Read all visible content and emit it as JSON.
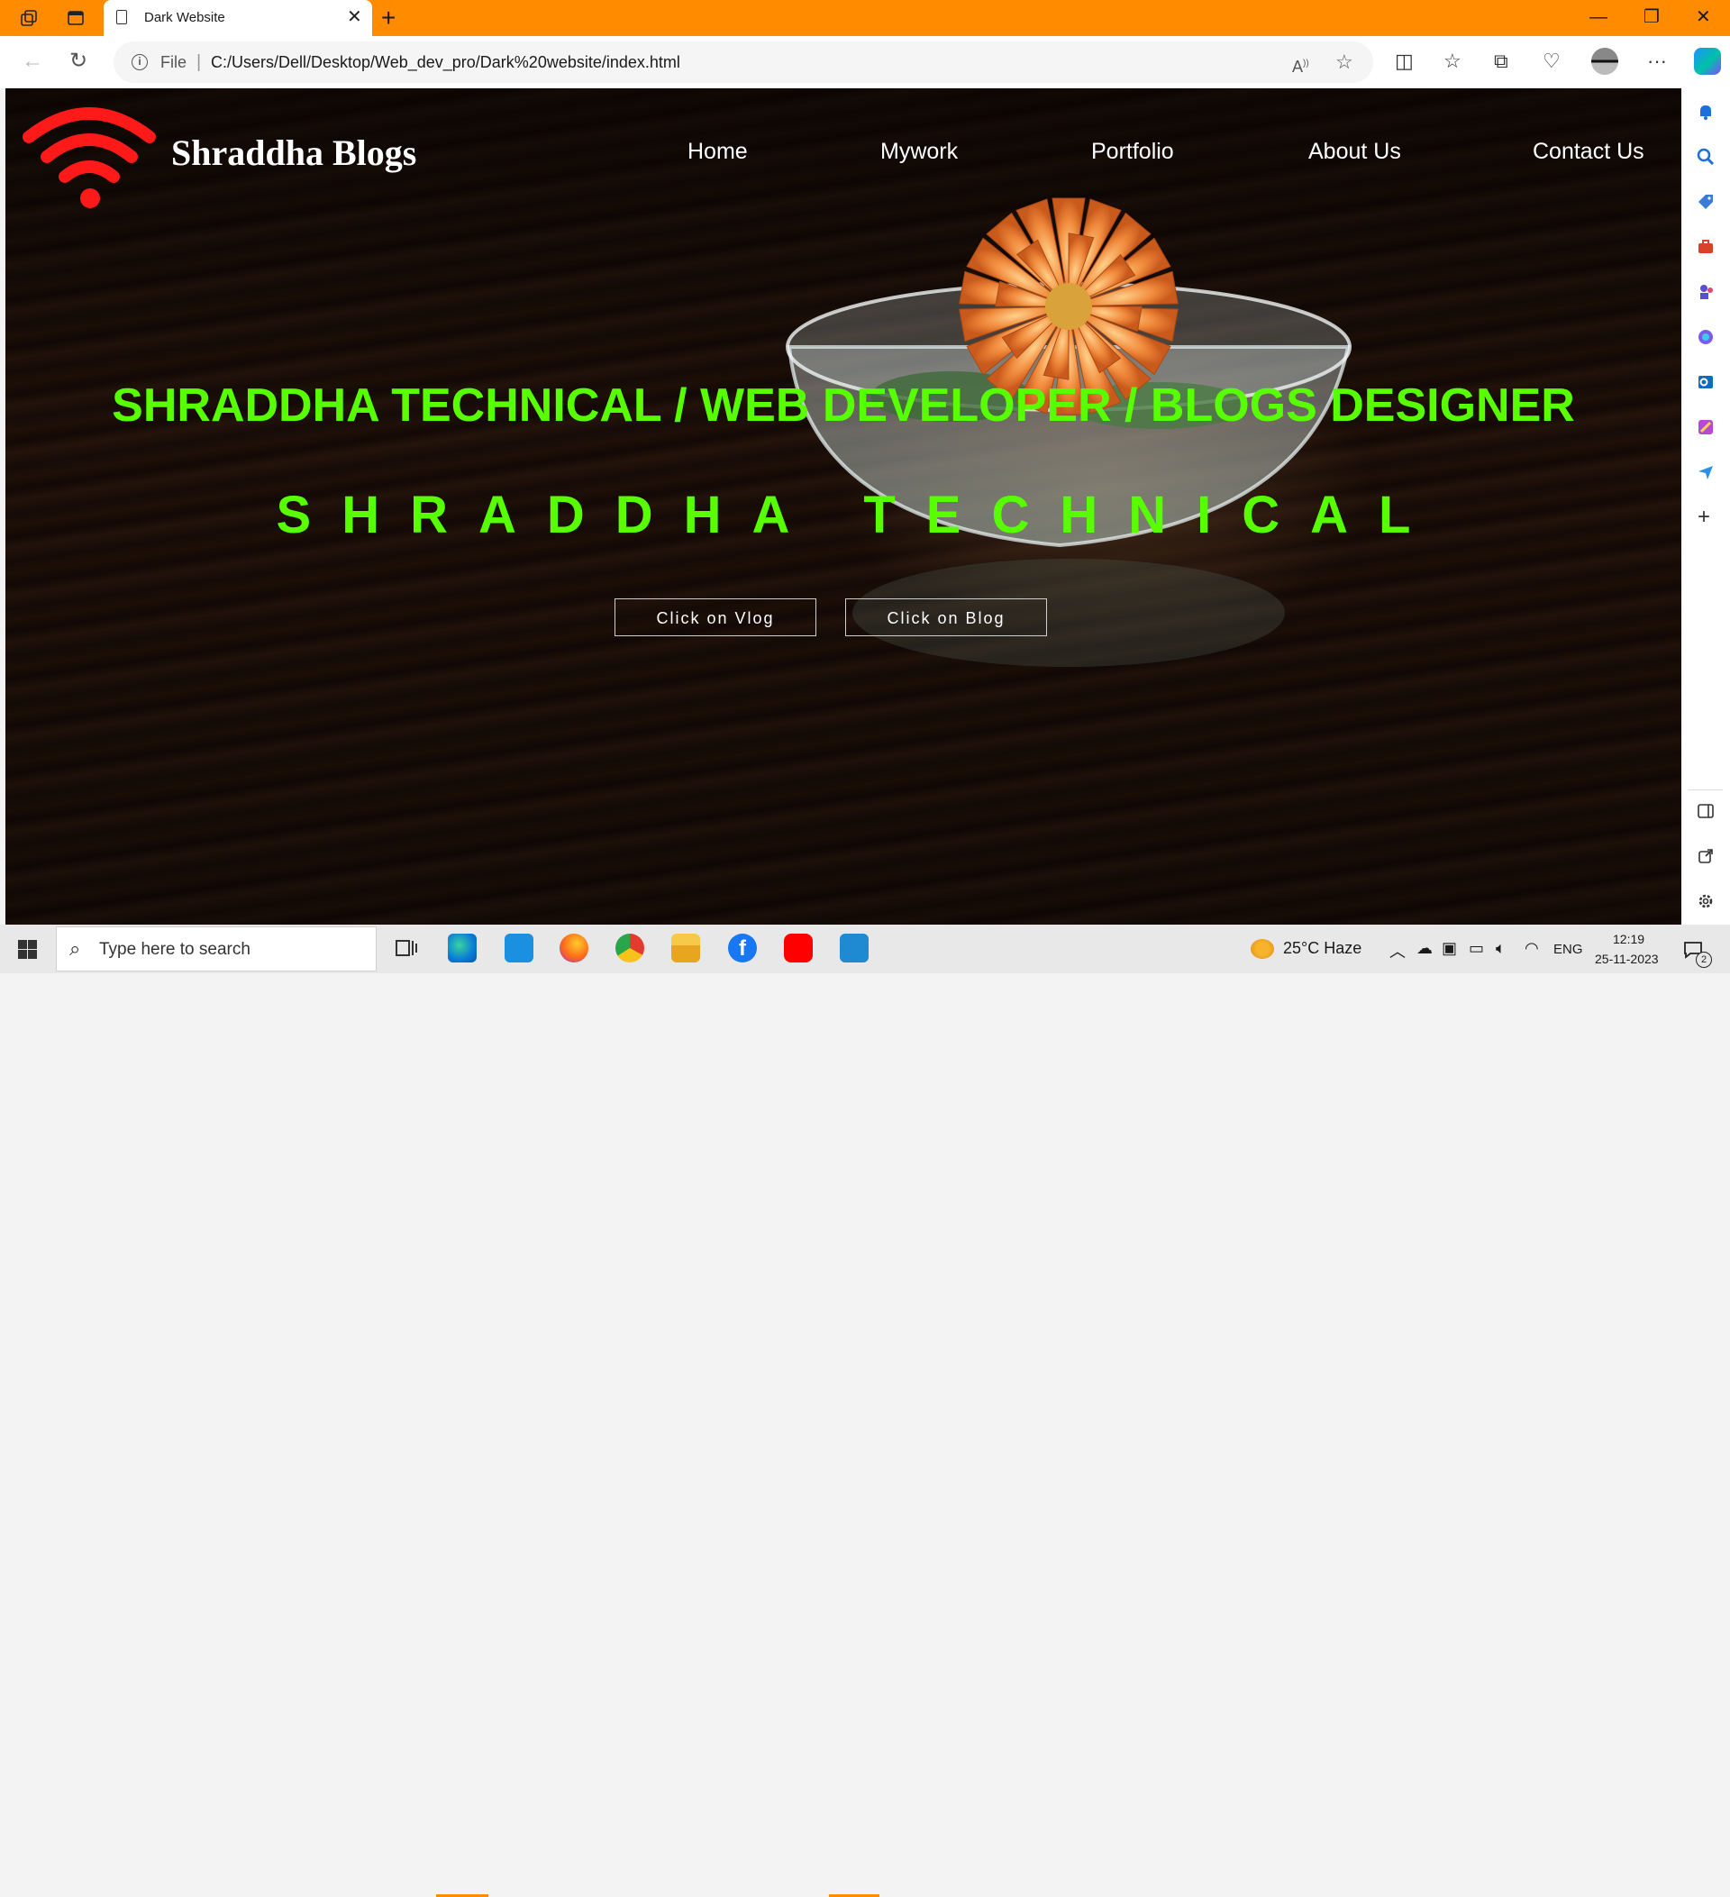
{
  "browser": {
    "tab_title": "Dark Website",
    "close_tab": "✕",
    "new_tab": "+",
    "file_label": "File",
    "separator": "|",
    "url": "C:/Users/Dell/Desktop/Web_dev_pro/Dark%20website/index.html"
  },
  "site": {
    "brand": "Shraddha Blogs",
    "nav": [
      "Home",
      "Mywork",
      "Portfolio",
      "About Us",
      "Contact Us"
    ],
    "headline": "SHRADDHA TECHNICAL / WEB DEVELOPER / BLOGS DESIGNER",
    "spaced_title": "SHRADDHA TECHNICAL",
    "buttons": [
      "Click on Vlog",
      "Click on Blog"
    ]
  },
  "taskbar": {
    "search_placeholder": "Type here to search",
    "weather": "25°C  Haze",
    "language": "ENG",
    "time": "12:19",
    "date": "25-11-2023",
    "notification_count": "2"
  },
  "colors": {
    "titlebar": "#ff8c00",
    "headline": "#57ff00",
    "logo": "#ff1a1a"
  }
}
